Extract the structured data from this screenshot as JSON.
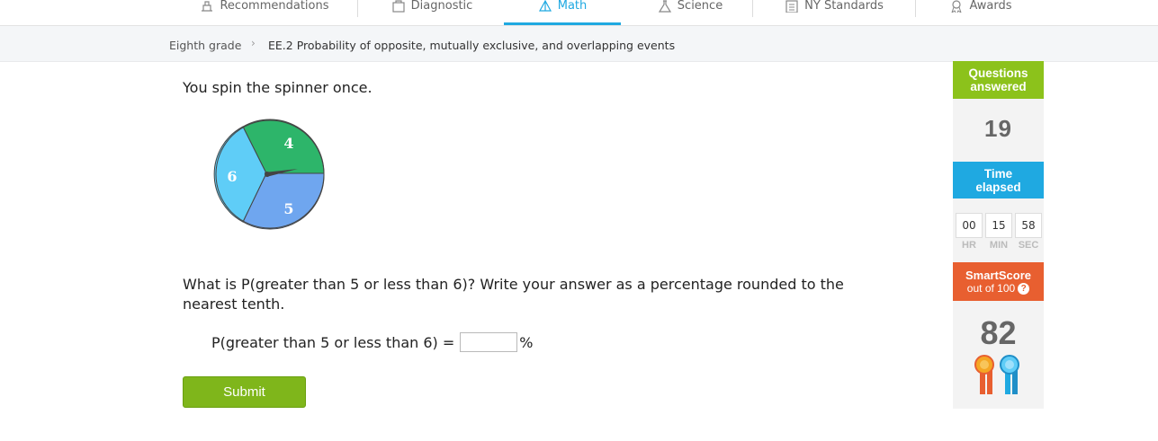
{
  "nav": {
    "tabs": [
      {
        "label": "Recommendations",
        "icon": "recommendations-icon"
      },
      {
        "label": "Diagnostic",
        "icon": "diagnostic-icon"
      },
      {
        "label": "Math",
        "icon": "math-icon",
        "active": true
      },
      {
        "label": "Science",
        "icon": "science-icon"
      },
      {
        "label": "NY Standards",
        "icon": "standards-icon"
      },
      {
        "label": "Awards",
        "icon": "awards-icon"
      }
    ],
    "active_color": "#1fa9e1"
  },
  "breadcrumb": {
    "grade": "Eighth grade",
    "skill": "EE.2 Probability of opposite, mutually exclusive, and overlapping events"
  },
  "question": {
    "intro": "You spin the spinner once.",
    "spinner": {
      "sections": [
        {
          "label": "4",
          "color": "#2db56a"
        },
        {
          "label": "5",
          "color": "#6fa6ef"
        },
        {
          "label": "6",
          "color": "#5fcdf7"
        }
      ]
    },
    "prompt": "What is P(greater than 5 or less than 6)? Write your answer as a percentage rounded to the nearest tenth.",
    "answer_label": "P(greater than 5 or less than 6) =",
    "answer_value": "",
    "answer_suffix": "%",
    "submit_label": "Submit"
  },
  "sidebar": {
    "questions_answered_line1": "Questions",
    "questions_answered_line2": "answered",
    "questions_answered_value": "19",
    "time_elapsed_line1": "Time",
    "time_elapsed_line2": "elapsed",
    "timer": {
      "hr": "00",
      "min": "15",
      "sec": "58"
    },
    "timer_labels": {
      "hr": "HR",
      "min": "MIN",
      "sec": "SEC"
    },
    "smartscore_title": "SmartScore",
    "smartscore_sub": "out of 100",
    "smartscore_help": "?",
    "smartscore_value": "82",
    "colors": {
      "questions": "#8cc21b",
      "time": "#1fa9e1",
      "smartscore": "#e85f30"
    }
  }
}
